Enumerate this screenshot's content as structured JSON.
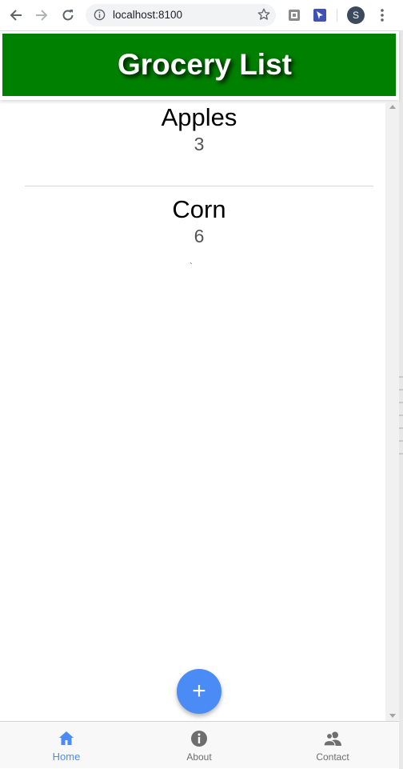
{
  "browser": {
    "url": "localhost:8100",
    "profile_initial": "S"
  },
  "header": {
    "title": "Grocery List",
    "background": "#008000"
  },
  "items": [
    {
      "name": "Apples",
      "quantity": "3"
    },
    {
      "name": "Corn",
      "quantity": "6"
    }
  ],
  "stray_text": "`",
  "fab": {
    "label": "+",
    "color": "#4b8bf5"
  },
  "tabs": [
    {
      "label": "Home",
      "icon": "home-icon",
      "active": true
    },
    {
      "label": "About",
      "icon": "info-icon",
      "active": false
    },
    {
      "label": "Contact",
      "icon": "contacts-icon",
      "active": false
    }
  ],
  "colors": {
    "accent": "#4b8bf5",
    "inactive": "#6e6e6e"
  }
}
